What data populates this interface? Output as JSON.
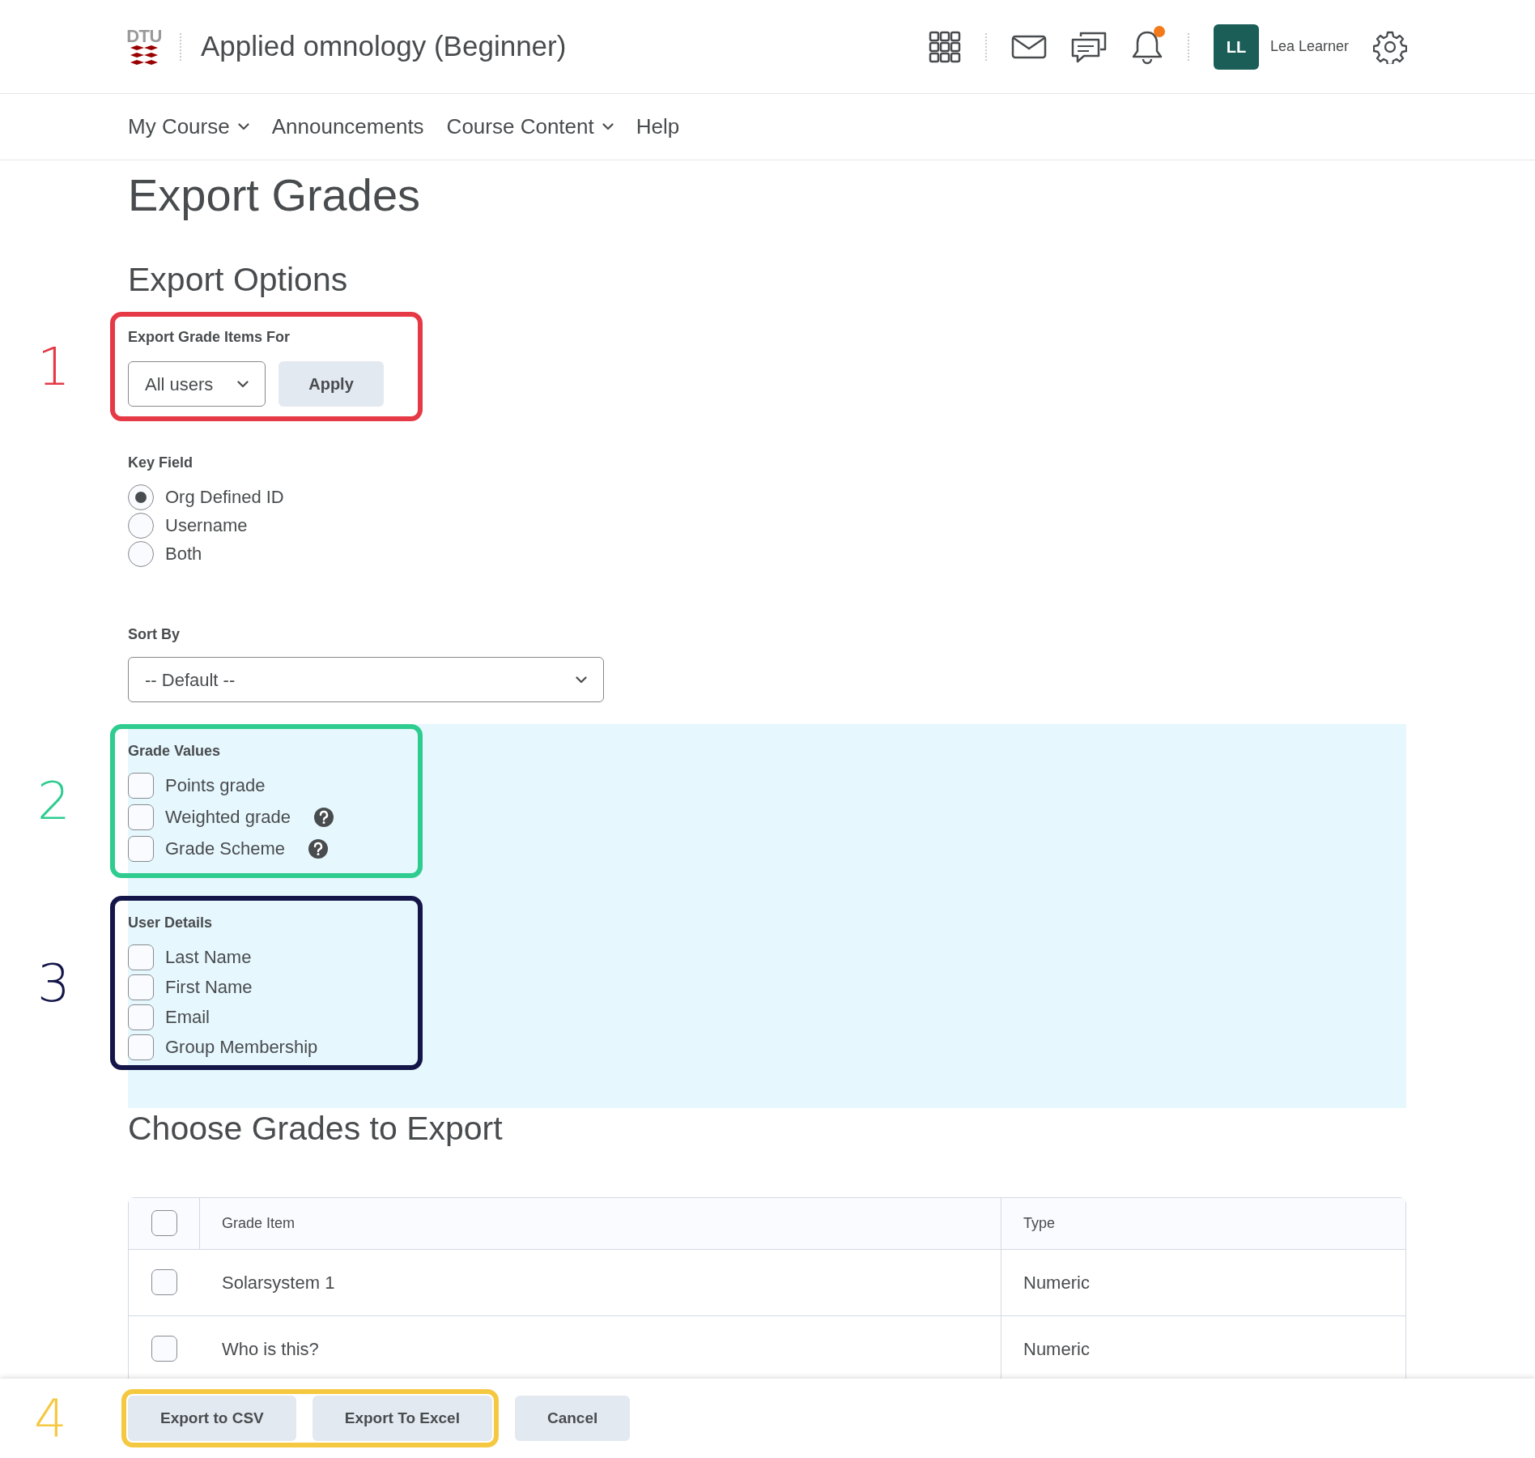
{
  "header": {
    "logo_text": "DTU",
    "course_title": "Applied omnology (Beginner)",
    "notifications_unread": true,
    "user": {
      "initials": "LL",
      "name": "Lea Learner"
    }
  },
  "nav": [
    {
      "label": "My Course",
      "dropdown": true
    },
    {
      "label": "Announcements",
      "dropdown": false
    },
    {
      "label": "Course Content",
      "dropdown": true
    },
    {
      "label": "Help",
      "dropdown": false
    }
  ],
  "page_title": "Export Grades",
  "options_heading": "Export Options",
  "export_for": {
    "annotation": {
      "number": "1",
      "color": "#e63946"
    },
    "label": "Export Grade Items For",
    "select_value": "All users",
    "button": "Apply"
  },
  "key_field": {
    "label": "Key Field",
    "options": [
      {
        "label": "Org Defined ID",
        "selected": true
      },
      {
        "label": "Username",
        "selected": false
      },
      {
        "label": "Both",
        "selected": false
      }
    ]
  },
  "sort_by": {
    "label": "Sort By",
    "select_value": "-- Default --"
  },
  "grade_values": {
    "annotation": {
      "number": "2",
      "color": "#2ecc8f"
    },
    "label": "Grade Values",
    "options": [
      {
        "label": "Points grade",
        "checked": false,
        "help": false
      },
      {
        "label": "Weighted grade",
        "checked": false,
        "help": true
      },
      {
        "label": "Grade Scheme",
        "checked": false,
        "help": true
      }
    ]
  },
  "user_details": {
    "annotation": {
      "number": "3",
      "color": "#14164a"
    },
    "label": "User Details",
    "options": [
      {
        "label": "Last Name",
        "checked": false
      },
      {
        "label": "First Name",
        "checked": false
      },
      {
        "label": "Email",
        "checked": false
      },
      {
        "label": "Group Membership",
        "checked": false
      }
    ]
  },
  "choose_heading": "Choose Grades to Export",
  "table": {
    "all_checked": false,
    "columns": [
      "Grade Item",
      "Type"
    ],
    "rows": [
      {
        "checked": false,
        "cells": [
          "Solarsystem 1",
          "Numeric"
        ]
      },
      {
        "checked": false,
        "cells": [
          "Who is this?",
          "Numeric"
        ]
      }
    ]
  },
  "footer": {
    "annotation": {
      "number": "4",
      "color": "#f5c842"
    },
    "buttons": [
      "Export to CSV",
      "Export To Excel",
      "Cancel"
    ]
  }
}
